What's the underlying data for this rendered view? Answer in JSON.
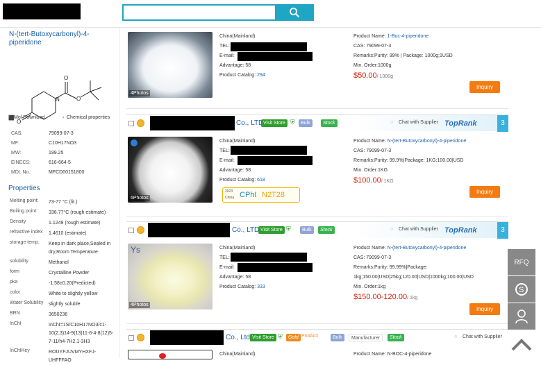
{
  "header": {
    "search_placeholder": ""
  },
  "product": {
    "title": "N-(tert-Butoxycarbonyl)-4-piperidone",
    "mol_download": "Mol Download",
    "chemical_properties": "Chemical properties",
    "basic": [
      {
        "k": "CAS:",
        "v": "79099-07-3"
      },
      {
        "k": "MF:",
        "v": "C10H17NO3"
      },
      {
        "k": "MW:",
        "v": "199.25"
      },
      {
        "k": "EINECS:",
        "v": "616-664-5"
      },
      {
        "k": "MDL No.:",
        "v": "MFCD00151800"
      }
    ],
    "properties_title": "Properties",
    "properties": [
      {
        "k": "Melting point:",
        "v": "73-77 °C (lit.)"
      },
      {
        "k": "Boiling point:",
        "v": "336.77°C (rough estimate)"
      },
      {
        "k": "Density",
        "v": "1.1249 (rough estimate)"
      },
      {
        "k": "refractive index",
        "v": "1.4610 (estimate)"
      },
      {
        "k": "storage temp.",
        "v": "Keep in dark place,Sealed in dry,Room Temperature"
      },
      {
        "k": "solubility",
        "v": "Methanol"
      },
      {
        "k": "form",
        "v": "Crystalline Powder"
      },
      {
        "k": "pka",
        "v": "-1.58±0.20(Predicted)"
      },
      {
        "k": "color",
        "v": "White to slightly yellow"
      },
      {
        "k": "Water Solubility",
        "v": "slightly soluble"
      },
      {
        "k": "BRN",
        "v": "3650236"
      },
      {
        "k": "InChI",
        "v": "InChI=1S/C10H17NO3/c1-10(2,3)14-9(13)11-6-4-8(12)5-7-11/h4-7H2,1-3H3"
      },
      {
        "k": "InChIKey",
        "v": "ROUYFJUVMYHXFJ-UHFFFAO"
      }
    ]
  },
  "listings": [
    {
      "photos": "4Photos",
      "region": "China(Mainland)",
      "tel": "TEL:",
      "email": "E-mail:",
      "advantage": "Advantage: 58",
      "catalog_label": "Product Catalog: ",
      "catalog": "294",
      "product_name_label": "Product Name: ",
      "product_name": "1-Boc-4-piperidone",
      "cas": "CAS: 79099-07-3",
      "remarks": "Remarks:Purity: 99% | Package: 1000g;1USD",
      "min_order": "Min. Order:1000g",
      "price": "$50.00",
      "price_unit": "/ 1000g",
      "inquiry": "Inquiry"
    },
    {
      "company_suffix": "Co., LTD",
      "visit": "Visit Store",
      "bulk": "Bulk",
      "stock": "Stock",
      "chat": "Chat with Supplier",
      "toprank": "TopRank",
      "rank": "3",
      "photos": "6Photos",
      "region": "China(Mainland)",
      "tel": "TEL:",
      "email": "E-mail:",
      "advantage": "Advantage: 58",
      "catalog_label": "Product Catalog: ",
      "catalog": "618",
      "cphi_year": "2023",
      "cphi_country": "China",
      "cphi_text": "CPhI",
      "cphi_code": "N2T28",
      "product_name_label": "Product Name: ",
      "product_name": "N-(tert-Butoxycarbonyl)-4-piperidone",
      "cas": "CAS: 79099-07-3",
      "remarks": "Remarks:Purity: 99.9%|Package: 1KG;100.00|USD",
      "min_order": "Min. Order:1KG",
      "price": "$100.00",
      "price_unit": "/ 1KG",
      "inquiry": "Inquiry"
    },
    {
      "company_suffix": "Co., LTD",
      "visit": "Visit Store",
      "bulk": "Bulk",
      "stock": "Stock",
      "chat": "Chat with Supplier",
      "toprank": "TopRank",
      "rank": "3",
      "photos": "4Photos",
      "region": "China(Mainland)",
      "tel": "TEL:",
      "email": "E-mail:",
      "advantage": "Advantage: 58",
      "catalog_label": "Product Catalog: ",
      "catalog": "333",
      "product_name_label": "Product Name: ",
      "product_name": "N-(tert-Butoxycarbonyl)-4-piperidone",
      "cas": "CAS: 79099-07-3",
      "remarks": "Remarks:Purity: 99.99%|Package: 1kg;150.00|USD|25kg;120.00|USD|1000kg;100.00|USD",
      "min_order": "Min. Order:1kg",
      "price": "$150.00-120.00",
      "price_unit": "/ 1kg",
      "inquiry": "Inquiry"
    },
    {
      "company_suffix": "Co., Ltd",
      "visit": "Visit Store",
      "gold": "Gold",
      "product_tag": "Product",
      "bulk": "Bulk",
      "manufacturer": "Manufacturer",
      "stock": "Stock",
      "chat": "Chat with Supplier",
      "region": "China(Mainland)",
      "product_name_label": "Product Name: ",
      "product_name": "N-BOC-4-piperidone"
    }
  ],
  "sidebar": {
    "rfq": "RFQ"
  }
}
